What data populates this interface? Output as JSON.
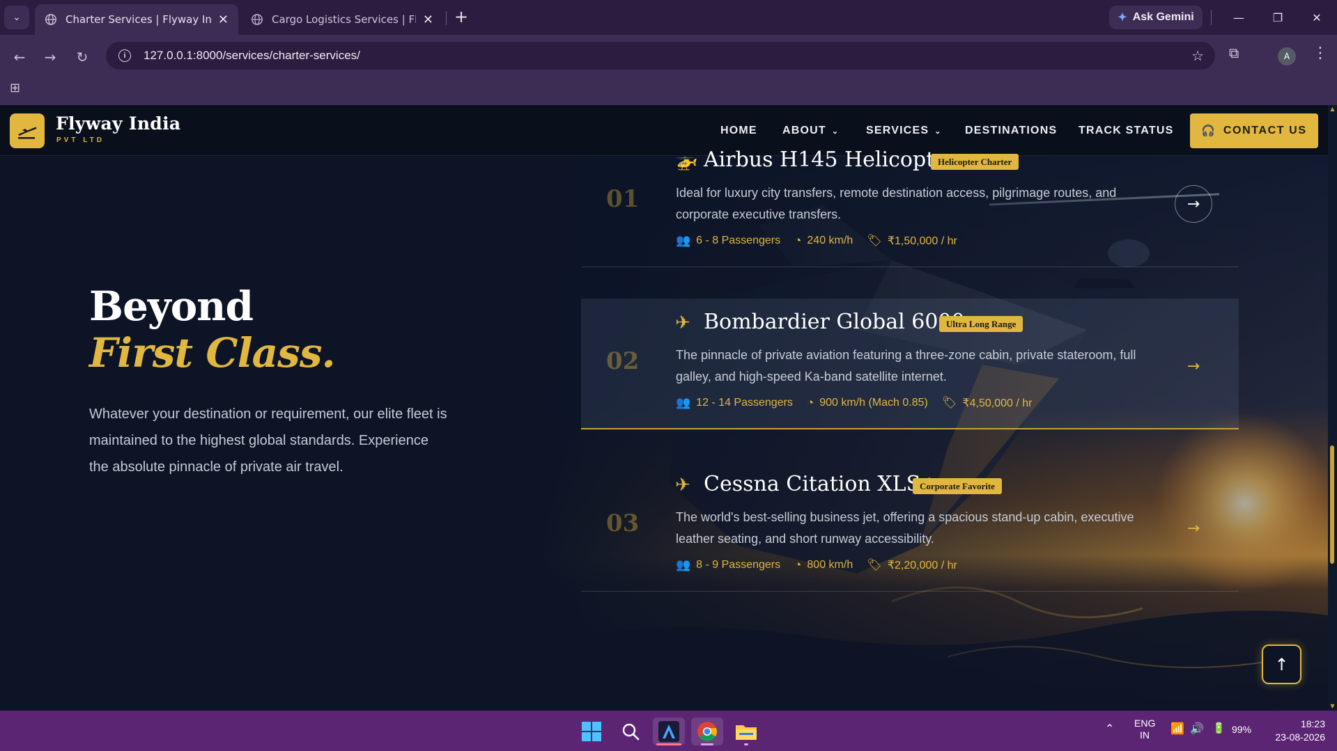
{
  "browser": {
    "tabs": [
      {
        "title": "Charter Services | Flyway India P",
        "active": true
      },
      {
        "title": "Cargo Logistics Services | Flyway",
        "active": false
      }
    ],
    "gemini_label": "Ask Gemini",
    "url": "127.0.0.1:8000/services/charter-services/",
    "profile_initial": "A"
  },
  "site": {
    "brand": "Flyway India",
    "brand_sub": "PVT LTD",
    "nav": {
      "home": "HOME",
      "about": "ABOUT",
      "services": "SERVICES",
      "destinations": "DESTINATIONS",
      "track": "TRACK STATUS"
    },
    "contact_label": "CONTACT US"
  },
  "hero": {
    "title_line1": "Beyond",
    "title_line2": "First Class.",
    "description": "Whatever your destination or requirement, our elite fleet is maintained to the highest global standards. Experience the absolute pinnacle of private air travel."
  },
  "fleet": [
    {
      "number": "01",
      "icon": "helicopter-icon",
      "title": "Airbus H145 Helicopter",
      "badge": "Helicopter Charter",
      "description": "Ideal for luxury city transfers, remote destination access, pilgrimage routes, and corporate executive transfers.",
      "passengers": "6 - 8 Passengers",
      "speed": "240 km/h",
      "price": "₹1,50,000 / hr"
    },
    {
      "number": "02",
      "icon": "plane-icon",
      "title": "Bombardier Global 6000",
      "badge": "Ultra Long Range",
      "description": "The pinnacle of private aviation featuring a three-zone cabin, private stateroom, full galley, and high-speed Ka-band satellite internet.",
      "passengers": "12 - 14 Passengers",
      "speed": "900 km/h (Mach 0.85)",
      "price": "₹4,50,000 / hr"
    },
    {
      "number": "03",
      "icon": "plane-icon",
      "title": "Cessna Citation XLS+",
      "badge": "Corporate Favorite",
      "description": "The world's best-selling business jet, offering a spacious stand-up cabin, executive leather seating, and short runway accessibility.",
      "passengers": "8 - 9 Passengers",
      "speed": "800 km/h",
      "price": "₹2,20,000 / hr"
    }
  ],
  "taskbar": {
    "lang_line1": "ENG",
    "lang_line2": "IN",
    "battery": "99%",
    "time": "18:23",
    "date": "23-08-2026"
  },
  "colors": {
    "accent_gold": "#e2b740",
    "page_bg": "#0c1426",
    "browser_frame": "#3d2d55",
    "taskbar": "#5b2574"
  }
}
